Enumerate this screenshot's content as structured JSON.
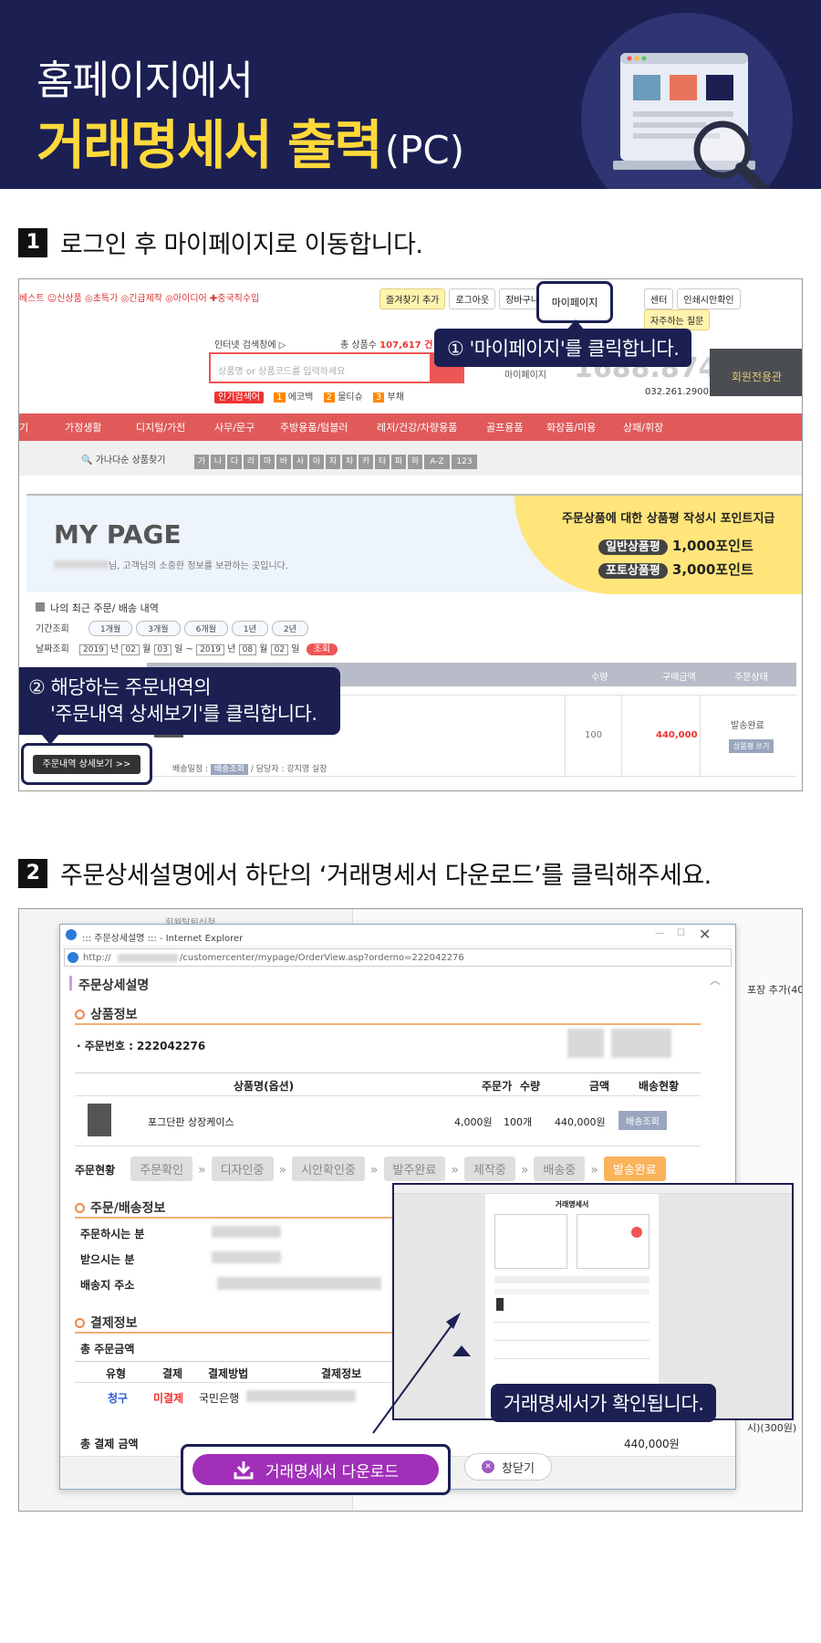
{
  "header": {
    "line1": "홈페이지에서",
    "line2": "거래명세서 출력",
    "line2_suffix": "(PC)"
  },
  "step1": {
    "num": "1",
    "title": "로그인 후 마이페이지로 이동합니다.",
    "topbar_left": "베스트 ☺신상품 ◎초특가 ◎긴급제작 ◎아이디어 ✚중국직수입",
    "topbar_buttons": [
      "즐겨찾기 추가",
      "로그아웃",
      "장바구니"
    ],
    "mypage_label": "마이페이지",
    "topbar_right": [
      "센터",
      "인쇄시안확인",
      "자주하는 질문"
    ],
    "search_title": "인터넷 검색창에 ▷",
    "total_label": "총 상품수",
    "total_value": "107,617 건",
    "search_placeholder": "상품명 or 상품코드를 입력하세요",
    "popular_label": "인기검색어",
    "popular_terms": [
      "1",
      "에코백",
      "2",
      "물티슈",
      "3",
      "부채"
    ],
    "phone_label": "마이페이지",
    "phone": "1688.8744",
    "phone2": "032.261.2900",
    "member_badge": "회원전용관",
    "callout1": "① '마이페이지'를 클릭합니다.",
    "categories": [
      "기",
      "가정생활",
      "디지털/가전",
      "사무/문구",
      "주방용품/텀블러",
      "레저/건강/차량용품",
      "골프용품",
      "화장품/미용",
      "상패/휘장"
    ],
    "alpha_label": "가나다순 상품찾기",
    "alpha": [
      "가",
      "나",
      "다",
      "라",
      "마",
      "바",
      "사",
      "아",
      "자",
      "차",
      "카",
      "타",
      "파",
      "하",
      "A-Z",
      "123"
    ],
    "mypage_title": "MY PAGE",
    "mypage_sub": "님, 고객님의 소중한 정보를 보관하는 곳입니다.",
    "review_banner": "주문상품에 대한 상품평 작성시 포인트지급",
    "review_general": "일반상품평",
    "review_general_pts": "1,000포인트",
    "review_photo": "포토상품평",
    "review_photo_pts": "3,000포인트",
    "recent_title": "나의 최근 주문/ 배송 내역",
    "period_label": "기간조회",
    "periods": [
      "1개월",
      "3개월",
      "6개월",
      "1년",
      "2년"
    ],
    "date_label": "날짜조회",
    "date_from": [
      "2019",
      "년",
      "02",
      "월",
      "03",
      "일 ~"
    ],
    "date_to": [
      "2019",
      "년",
      "08",
      "월",
      "02",
      "일"
    ],
    "search_btn": "조회",
    "col_qty": "수량",
    "col_price": "구매금액",
    "col_status": "주문상태",
    "qty": "100",
    "price": "440,000",
    "status": "발송완료",
    "review_btn": "상품평 쓰기",
    "detail_btn": "주문내역 상세보기 >>",
    "delivery_line": "배송일정 : ",
    "delivery_btn": "배송조회",
    "manager": " / 담당자 : 강지영 실장",
    "callout2_line1": "② 해당하는 주문내역의",
    "callout2_line2": "'주문내역 상세보기'를 클릭합니다."
  },
  "step2": {
    "num": "2",
    "title": "주문상세설명에서 하단의 ‘거래명세서 다운로드’를 클릭해주세요.",
    "bg_text": "회원탈퇴신청",
    "ie_title": "::: 주문상세설명 ::: - Internet Explorer",
    "url_prefix": "http://",
    "url_rest": "/customercenter/mypage/OrderView.asp?orderno=222042276",
    "page_title": "주문상세설명",
    "product_info": "상품정보",
    "order_no": "· 주문번호 : 222042276",
    "th_product": "상품명(옵션)",
    "th_unit": "주문가",
    "th_qty": "수량",
    "th_amount": "금액",
    "th_delivery": "배송현황",
    "product_name": "포그단판 상장케이스",
    "unit_price": "4,000원",
    "qty": "100개",
    "amount": "440,000원",
    "delivery_btn": "배송조회",
    "status_label": "주문현황",
    "flow": [
      "주문확인",
      "디자인중",
      "시안확인중",
      "발주완료",
      "제작중",
      "배송중",
      "발송완료"
    ],
    "order_info": "주문/배송정보",
    "orderer": "주문하시는 분",
    "receiver": "받으시는 분",
    "address": "배송지 주소",
    "pay_info": "결제정보",
    "total_order": "총 주문금액",
    "pay_cols": [
      "유형",
      "결제",
      "결제방법",
      "결제정보"
    ],
    "pay_type": "청구",
    "pay_state": "미결제",
    "pay_method": "국민은행",
    "total_pay_label": "총 결제 금액",
    "total_pay": "440,000원",
    "right_note1": "포장 추가(40",
    "right_note2": "시)(300원)",
    "invoice_title": "거래명세서",
    "invoice_callout": "거래명세서가 확인됩니다.",
    "download_btn": "거래명세서 다운로드",
    "close_btn": "창닫기"
  }
}
